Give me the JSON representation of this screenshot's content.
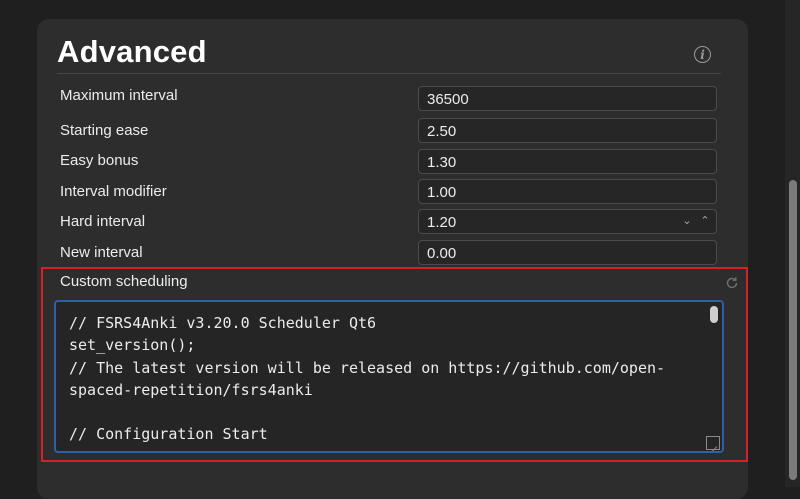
{
  "section": {
    "title": "Advanced",
    "info_icon": "info-icon"
  },
  "rows": [
    {
      "label": "Maximum interval",
      "value": "36500"
    },
    {
      "label": "Starting ease",
      "value": "2.50"
    },
    {
      "label": "Easy bonus",
      "value": "1.30"
    },
    {
      "label": "Interval modifier",
      "value": "1.00"
    },
    {
      "label": "Hard interval",
      "value": "1.20"
    },
    {
      "label": "New interval",
      "value": "0.00"
    }
  ],
  "custom_scheduling": {
    "label": "Custom scheduling",
    "reset_icon": "reset-icon",
    "code_lines": [
      "// FSRS4Anki v3.20.0 Scheduler Qt6",
      "set_version();",
      "// The latest version will be released on https://github.com/open-",
      "spaced-repetition/fsrs4anki",
      "",
      "// Configuration Start"
    ]
  },
  "colors": {
    "highlight_border": "#d81e26",
    "editor_focus": "#2e5fa8"
  }
}
